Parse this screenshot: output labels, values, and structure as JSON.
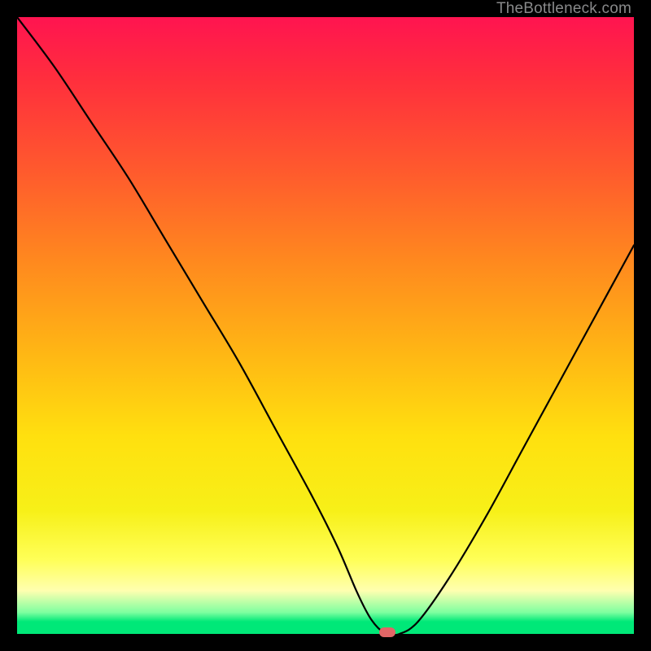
{
  "watermark": "TheBottleneck.com",
  "chart_data": {
    "type": "line",
    "title": "",
    "xlabel": "",
    "ylabel": "",
    "xlim": [
      0,
      100
    ],
    "ylim": [
      0,
      100
    ],
    "x": [
      0,
      6,
      12,
      18,
      24,
      30,
      36,
      42,
      48,
      52,
      55,
      57,
      58.5,
      60,
      62,
      65,
      70,
      76,
      82,
      88,
      94,
      100
    ],
    "values": [
      100,
      92,
      83,
      74,
      64,
      54,
      44,
      33,
      22,
      14,
      7,
      3,
      1,
      0,
      0,
      2,
      9,
      19,
      30,
      41,
      52,
      63
    ],
    "marker": {
      "x": 60,
      "y": 0
    },
    "gradient_stops": [
      {
        "pos": 0.0,
        "color": "#ff1450"
      },
      {
        "pos": 0.1,
        "color": "#ff2e3d"
      },
      {
        "pos": 0.25,
        "color": "#ff5a2d"
      },
      {
        "pos": 0.4,
        "color": "#ff8a1e"
      },
      {
        "pos": 0.55,
        "color": "#ffb814"
      },
      {
        "pos": 0.68,
        "color": "#ffe00f"
      },
      {
        "pos": 0.8,
        "color": "#f7f018"
      },
      {
        "pos": 0.88,
        "color": "#ffff58"
      },
      {
        "pos": 0.93,
        "color": "#ffffb0"
      },
      {
        "pos": 0.965,
        "color": "#7fffa0"
      },
      {
        "pos": 0.98,
        "color": "#00e878"
      },
      {
        "pos": 1.0,
        "color": "#00e878"
      }
    ]
  }
}
